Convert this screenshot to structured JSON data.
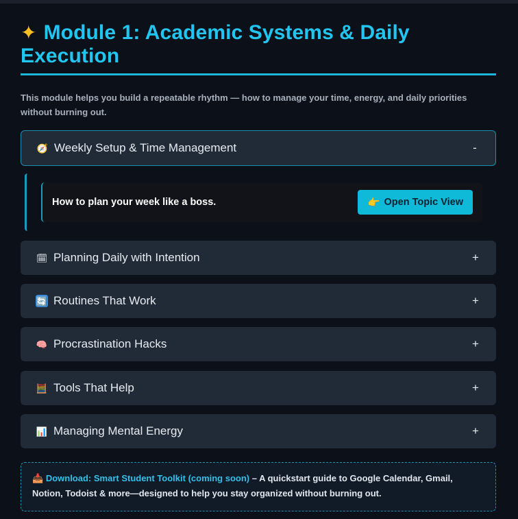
{
  "module": {
    "title_icon": "sparkle-icon",
    "title": "Module 1: Academic Systems & Daily Execution",
    "intro": "This module helps you build a repeatable rhythm — how to manage your time, energy, and daily priorities without burning out."
  },
  "accordion": [
    {
      "icon": "compass-icon",
      "emoji": "🧭",
      "label": "Weekly Setup & Time Management",
      "toggle": "-",
      "expanded": true
    },
    {
      "icon": "calendar-icon",
      "emoji": "🗓",
      "label": "Planning Daily with Intention",
      "toggle": "+",
      "expanded": false
    },
    {
      "icon": "repeat-icon",
      "emoji": "🔄",
      "label": "Routines That Work",
      "toggle": "+",
      "expanded": false
    },
    {
      "icon": "brain-icon",
      "emoji": "🧠",
      "label": "Procrastination Hacks",
      "toggle": "+",
      "expanded": false
    },
    {
      "icon": "abacus-icon",
      "emoji": "🧮",
      "label": "Tools That Help",
      "toggle": "+",
      "expanded": false
    },
    {
      "icon": "bar-chart-icon",
      "emoji": "📊",
      "label": "Managing Mental Energy",
      "toggle": "+",
      "expanded": false
    }
  ],
  "expanded_panel": {
    "text": "How to plan your week like a boss.",
    "button_icon": "pointing-hand-icon",
    "button_emoji": "👉",
    "button_label": "Open Topic View"
  },
  "toolkit": {
    "icon": "inbox-icon",
    "emoji": "📥",
    "link_text": "Download: Smart Student Toolkit (coming soon)",
    "description": " – A quickstart guide to Google Calendar, Gmail, Notion, Todoist & more—designed to help you stay organized without burning out."
  },
  "colors": {
    "accent": "#22c5ef",
    "background": "#0b1019",
    "card": "#212a37",
    "button": "#0fb9d8"
  }
}
